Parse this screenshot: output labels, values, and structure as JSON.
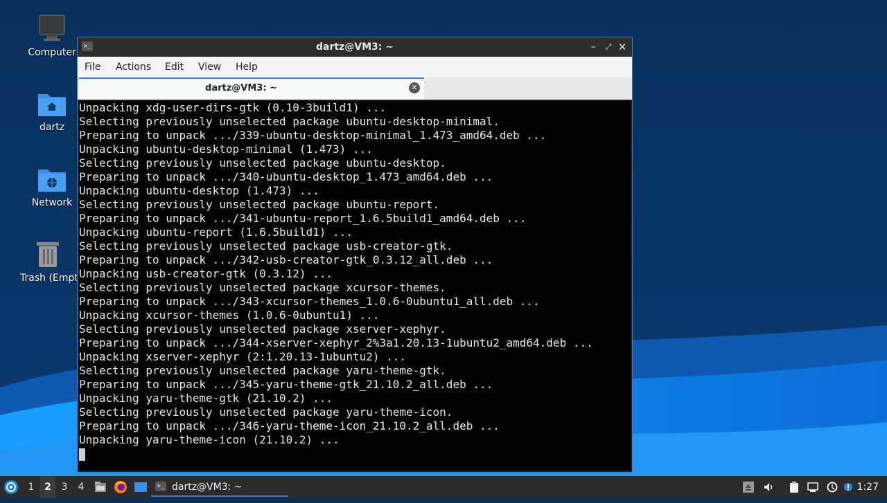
{
  "desktop": {
    "icons": [
      {
        "label": "Computer",
        "icon": "computer-icon"
      },
      {
        "label": "dartz",
        "icon": "home-folder-icon"
      },
      {
        "label": "Network",
        "icon": "network-folder-icon"
      },
      {
        "label": "Trash (Empty)",
        "icon": "trash-icon"
      }
    ]
  },
  "window": {
    "title": "dartz@VM3: ~",
    "menu": [
      "File",
      "Actions",
      "Edit",
      "View",
      "Help"
    ],
    "tab_label": "dartz@VM3: ~"
  },
  "terminal": {
    "lines": [
      "Unpacking xdg-user-dirs-gtk (0.10-3build1) ...",
      "Selecting previously unselected package ubuntu-desktop-minimal.",
      "Preparing to unpack .../339-ubuntu-desktop-minimal_1.473_amd64.deb ...",
      "Unpacking ubuntu-desktop-minimal (1.473) ...",
      "Selecting previously unselected package ubuntu-desktop.",
      "Preparing to unpack .../340-ubuntu-desktop_1.473_amd64.deb ...",
      "Unpacking ubuntu-desktop (1.473) ...",
      "Selecting previously unselected package ubuntu-report.",
      "Preparing to unpack .../341-ubuntu-report_1.6.5build1_amd64.deb ...",
      "Unpacking ubuntu-report (1.6.5build1) ...",
      "Selecting previously unselected package usb-creator-gtk.",
      "Preparing to unpack .../342-usb-creator-gtk_0.3.12_all.deb ...",
      "Unpacking usb-creator-gtk (0.3.12) ...",
      "Selecting previously unselected package xcursor-themes.",
      "Preparing to unpack .../343-xcursor-themes_1.0.6-0ubuntu1_all.deb ...",
      "Unpacking xcursor-themes (1.0.6-0ubuntu1) ...",
      "Selecting previously unselected package xserver-xephyr.",
      "Preparing to unpack .../344-xserver-xephyr_2%3a1.20.13-1ubuntu2_amd64.deb ...",
      "Unpacking xserver-xephyr (2:1.20.13-1ubuntu2) ...",
      "Selecting previously unselected package yaru-theme-gtk.",
      "Preparing to unpack .../345-yaru-theme-gtk_21.10.2_all.deb ...",
      "Unpacking yaru-theme-gtk (21.10.2) ...",
      "Selecting previously unselected package yaru-theme-icon.",
      "Preparing to unpack .../346-yaru-theme-icon_21.10.2_all.deb ...",
      "Unpacking yaru-theme-icon (21.10.2) ..."
    ]
  },
  "taskbar": {
    "workspaces": [
      "1",
      "2",
      "3",
      "4"
    ],
    "active_workspace": "2",
    "task_label": "dartz@VM3: ~",
    "clock": "1:27"
  },
  "colors": {
    "accent": "#3a7bd5",
    "desktop_dark": "#0a2e56",
    "desktop_wave": "#1e88e5"
  }
}
